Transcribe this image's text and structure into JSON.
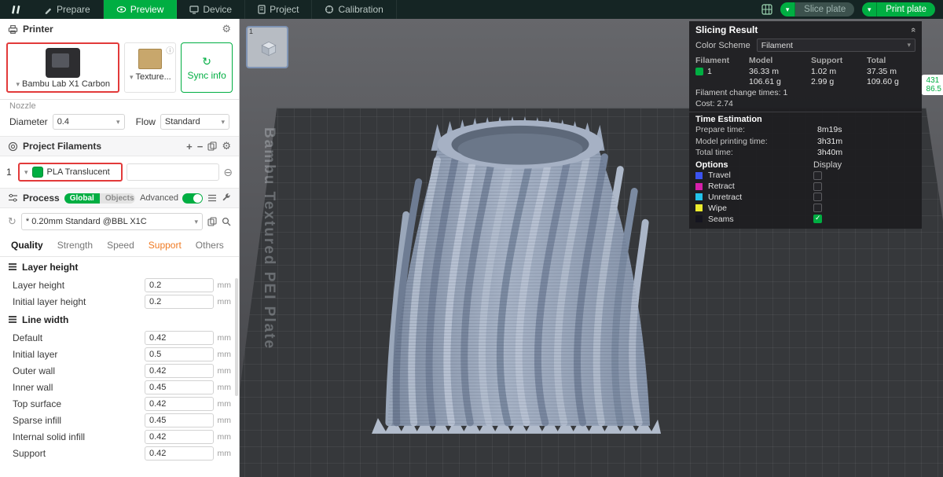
{
  "colors": {
    "accent": "#00ae42",
    "alert_outline": "#e23a3a"
  },
  "topbar": {
    "tabs": [
      {
        "label": "Prepare"
      },
      {
        "label": "Preview"
      },
      {
        "label": "Device"
      },
      {
        "label": "Project"
      },
      {
        "label": "Calibration"
      }
    ],
    "slice_plate_label": "Slice plate",
    "print_plate_label": "Print plate"
  },
  "printer": {
    "title": "Printer",
    "name": "Bambu Lab X1 Carbon",
    "plate": "Texture...",
    "sync_label": "Sync info",
    "nozzle_label": "Nozzle",
    "diameter_label": "Diameter",
    "diameter_value": "0.4",
    "flow_label": "Flow",
    "flow_value": "Standard"
  },
  "filaments": {
    "title": "Project Filaments",
    "index": "1",
    "name": "PLA Translucent",
    "color": "#00ae42"
  },
  "process": {
    "title": "Process",
    "global_label": "Global",
    "objects_label": "Objects",
    "advanced_label": "Advanced",
    "preset": "* 0.20mm Standard @BBL X1C",
    "tabs": [
      {
        "label": "Quality"
      },
      {
        "label": "Strength"
      },
      {
        "label": "Speed"
      },
      {
        "label": "Support"
      },
      {
        "label": "Others"
      }
    ],
    "sections": [
      {
        "title": "Layer height",
        "rows": [
          {
            "label": "Layer height",
            "value": "0.2",
            "unit": "mm"
          },
          {
            "label": "Initial layer height",
            "value": "0.2",
            "unit": "mm"
          }
        ]
      },
      {
        "title": "Line width",
        "rows": [
          {
            "label": "Default",
            "value": "0.42",
            "unit": "mm"
          },
          {
            "label": "Initial layer",
            "value": "0.5",
            "unit": "mm"
          },
          {
            "label": "Outer wall",
            "value": "0.42",
            "unit": "mm"
          },
          {
            "label": "Inner wall",
            "value": "0.45",
            "unit": "mm"
          },
          {
            "label": "Top surface",
            "value": "0.42",
            "unit": "mm"
          },
          {
            "label": "Sparse infill",
            "value": "0.45",
            "unit": "mm"
          },
          {
            "label": "Internal solid infill",
            "value": "0.42",
            "unit": "mm"
          },
          {
            "label": "Support",
            "value": "0.42",
            "unit": "mm"
          }
        ]
      }
    ]
  },
  "viewport": {
    "plate_number": "1",
    "watermark": "Bambu Textured PEI Plate",
    "layer_value": "431",
    "height_value": "86.5"
  },
  "slicing": {
    "title": "Slicing Result",
    "color_scheme_label": "Color Scheme",
    "color_scheme_value": "Filament",
    "headers": [
      "Filament",
      "Model",
      "Support",
      "Total"
    ],
    "row": {
      "filament": "1",
      "model_len": "36.33 m",
      "model_wt": "106.61 g",
      "support_len": "1.02 m",
      "support_wt": "2.99 g",
      "total_len": "37.35 m",
      "total_wt": "109.60 g"
    },
    "change_times": "Filament change times: 1",
    "cost": "Cost: 2.74",
    "time_title": "Time Estimation",
    "times": [
      {
        "label": "Prepare time:",
        "value": "8m19s"
      },
      {
        "label": "Model printing time:",
        "value": "3h31m"
      },
      {
        "label": "Total time:",
        "value": "3h40m"
      }
    ],
    "options_title": "Options",
    "display_title": "Display",
    "options": [
      {
        "label": "Travel",
        "color": "#3b53f0",
        "checked": false
      },
      {
        "label": "Retract",
        "color": "#d620aa",
        "checked": false
      },
      {
        "label": "Unretract",
        "color": "#23c3ea",
        "checked": false
      },
      {
        "label": "Wipe",
        "color": "#ecec2d",
        "checked": false
      },
      {
        "label": "Seams",
        "color": "#15151f",
        "checked": true
      }
    ]
  }
}
